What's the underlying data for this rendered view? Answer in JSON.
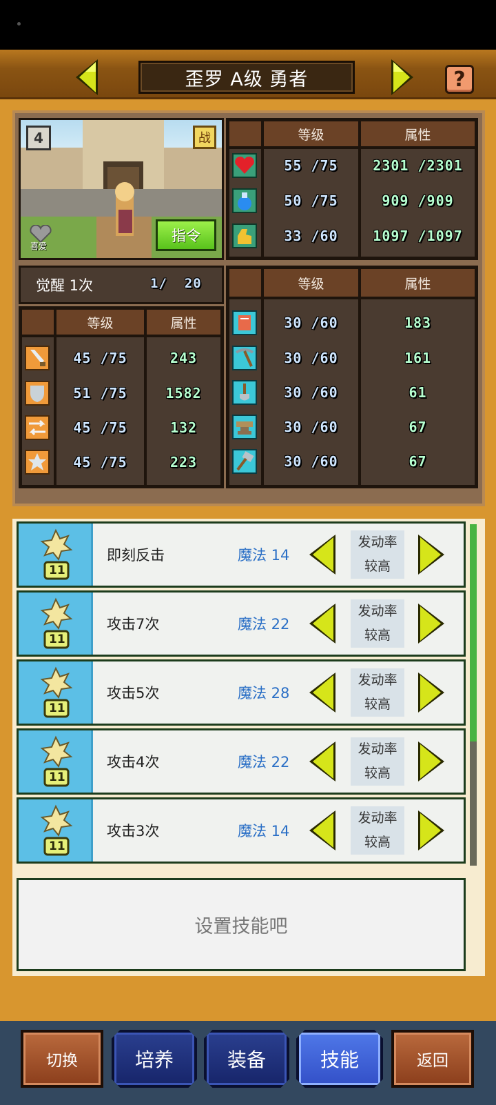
{
  "header": {
    "title": "歪罗 A级 勇者",
    "help_label": "?"
  },
  "hero": {
    "level_badge": "4",
    "battle_badge": "战",
    "favorite_label": "喜爱",
    "command_label": "指令",
    "awaken_label": "觉醒 1次",
    "awaken_progress": "1/  20"
  },
  "stats_top": {
    "col_level": "等级",
    "col_attr": "属性",
    "rows": [
      {
        "icon": "heart-icon",
        "level": "55 /75",
        "attr": "2301 /2301"
      },
      {
        "icon": "potion-icon",
        "level": "50 /75",
        "attr": "909 /909"
      },
      {
        "icon": "strength-icon",
        "level": "33 /60",
        "attr": "1097 /1097"
      }
    ]
  },
  "stats_left": {
    "col_level": "等级",
    "col_attr": "属性",
    "rows": [
      {
        "icon": "sword-icon",
        "level": "45 /75",
        "attr": "243"
      },
      {
        "icon": "shield-icon",
        "level": "51 /75",
        "attr": "1582"
      },
      {
        "icon": "arrows-icon",
        "level": "45 /75",
        "attr": "132"
      },
      {
        "icon": "star-icon",
        "level": "45 /75",
        "attr": "223"
      }
    ]
  },
  "stats_right": {
    "col_level": "等级",
    "col_attr": "属性",
    "rows": [
      {
        "icon": "book-icon",
        "level": "30 /60",
        "attr": "183"
      },
      {
        "icon": "pickaxe-icon",
        "level": "30 /60",
        "attr": "161"
      },
      {
        "icon": "shovel-icon",
        "level": "30 /60",
        "attr": "61"
      },
      {
        "icon": "anvil-icon",
        "level": "30 /60",
        "attr": "67"
      },
      {
        "icon": "hammer-icon",
        "level": "30 /60",
        "attr": "67"
      }
    ]
  },
  "skills": [
    {
      "name": "即刻反击",
      "magic": "魔法 14",
      "rate1": "发动率",
      "rate2": "较高",
      "badge": "11"
    },
    {
      "name": "攻击7次",
      "magic": "魔法 22",
      "rate1": "发动率",
      "rate2": "较高",
      "badge": "11"
    },
    {
      "name": "攻击5次",
      "magic": "魔法 28",
      "rate1": "发动率",
      "rate2": "较高",
      "badge": "11"
    },
    {
      "name": "攻击4次",
      "magic": "魔法 22",
      "rate1": "发动率",
      "rate2": "较高",
      "badge": "11"
    },
    {
      "name": "攻击3次",
      "magic": "魔法 14",
      "rate1": "发动率",
      "rate2": "较高",
      "badge": "11"
    }
  ],
  "set_skill_prompt": "设置技能吧",
  "bottom_nav": {
    "switch": "切换",
    "train": "培养",
    "equip": "装备",
    "skills": "技能",
    "back": "返回"
  },
  "colors": {
    "accent_green": "#59c21c",
    "arrow_yellow": "#d6e51a",
    "magic_blue": "#2a6fc6"
  }
}
